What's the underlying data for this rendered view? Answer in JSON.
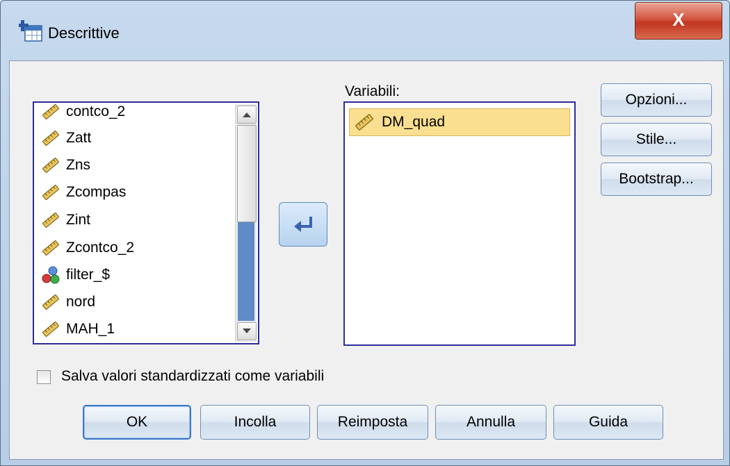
{
  "window": {
    "title": "Descrittive",
    "close_label": "X"
  },
  "source_list": {
    "items": [
      {
        "label": "contco_2",
        "icon": "scale-ruler-icon"
      },
      {
        "label": "Zatt",
        "icon": "scale-ruler-icon"
      },
      {
        "label": "Zns",
        "icon": "scale-ruler-icon"
      },
      {
        "label": "Zcompas",
        "icon": "scale-ruler-icon"
      },
      {
        "label": "Zint",
        "icon": "scale-ruler-icon"
      },
      {
        "label": "Zcontco_2",
        "icon": "scale-ruler-icon"
      },
      {
        "label": "filter_$",
        "icon": "nominal-balls-icon"
      },
      {
        "label": "nord",
        "icon": "scale-ruler-icon"
      },
      {
        "label": "MAH_1",
        "icon": "scale-ruler-icon"
      }
    ]
  },
  "variables": {
    "label": "Variabili:",
    "items": [
      {
        "label": "DM_quad",
        "icon": "scale-ruler-icon",
        "selected": true
      }
    ]
  },
  "side_buttons": {
    "options": "Opzioni...",
    "style": "Stile...",
    "bootstrap": "Bootstrap..."
  },
  "checkbox": {
    "label": "Salva valori standardizzati come variabili",
    "checked": false
  },
  "bottom_buttons": {
    "ok": "OK",
    "paste": "Incolla",
    "reset": "Reimposta",
    "cancel": "Annulla",
    "help": "Guida"
  },
  "colors": {
    "selection": "#fbdf91",
    "list_border": "#2c2c9e",
    "close_button": "#c2361f"
  }
}
